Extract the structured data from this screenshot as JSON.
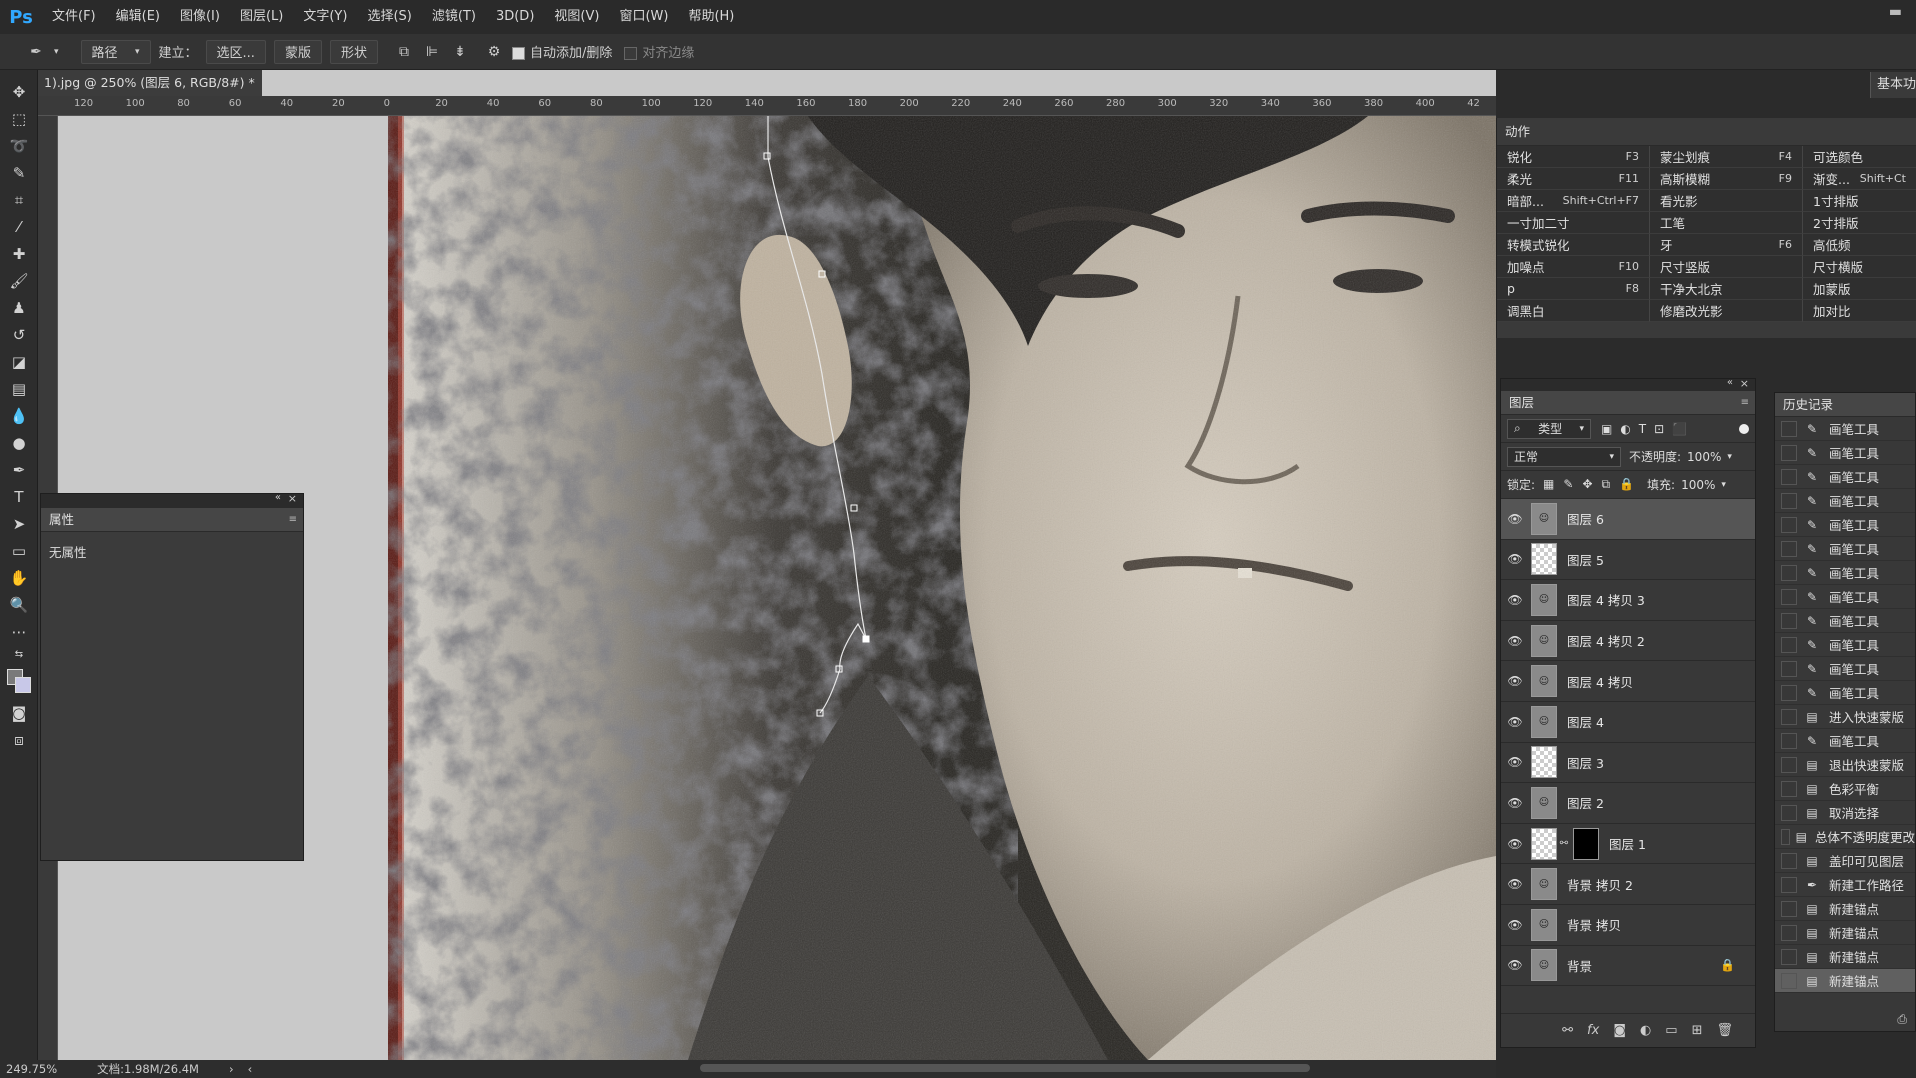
{
  "app": {
    "logo": "Ps"
  },
  "menu": [
    "文件(F)",
    "编辑(E)",
    "图像(I)",
    "图层(L)",
    "文字(Y)",
    "选择(S)",
    "滤镜(T)",
    "3D(D)",
    "视图(V)",
    "窗口(W)",
    "帮助(H)"
  ],
  "options": {
    "mode": "路径",
    "make_label": "建立：",
    "selection_btn": "选区...",
    "mask_btn": "蒙版",
    "shape_btn": "形状",
    "auto_add": "自动添加/删除",
    "align_edges": "对齐边缘",
    "workspace": "基本功能"
  },
  "document": {
    "tab_title": "1).jpg @ 250% (图层 6, RGB/8#) *",
    "ruler_ticks": [
      "120",
      "100",
      "80",
      "60",
      "40",
      "20",
      "0",
      "20",
      "40",
      "60",
      "80",
      "100",
      "120",
      "140",
      "160",
      "180",
      "200",
      "220",
      "240",
      "260",
      "280",
      "300",
      "320",
      "340",
      "360",
      "380",
      "400",
      "42"
    ]
  },
  "properties": {
    "title": "属性",
    "body": "无属性"
  },
  "actions": {
    "title": "动作",
    "items": [
      {
        "label": "锐化",
        "key": "F3"
      },
      {
        "label": "蒙尘划痕",
        "key": "F4"
      },
      {
        "label": "可选颜色",
        "key": ""
      },
      {
        "label": "柔光",
        "key": "F11"
      },
      {
        "label": "高斯模糊",
        "key": "F9"
      },
      {
        "label": "渐变...",
        "key": "Shift+Ct"
      },
      {
        "label": "暗部...",
        "key": "Shift+Ctrl+F7"
      },
      {
        "label": "看光影",
        "key": ""
      },
      {
        "label": "1寸排版",
        "key": ""
      },
      {
        "label": "一寸加二寸",
        "key": ""
      },
      {
        "label": "工笔",
        "key": ""
      },
      {
        "label": "2寸排版",
        "key": ""
      },
      {
        "label": "转模式锐化",
        "key": ""
      },
      {
        "label": "牙",
        "key": "F6"
      },
      {
        "label": "高低频",
        "key": ""
      },
      {
        "label": "加噪点",
        "key": "F10"
      },
      {
        "label": "尺寸竖版",
        "key": ""
      },
      {
        "label": "尺寸横版",
        "key": ""
      },
      {
        "label": "p",
        "key": "F8"
      },
      {
        "label": "干净大北京",
        "key": ""
      },
      {
        "label": "加蒙版",
        "key": ""
      },
      {
        "label": "调黑白",
        "key": ""
      },
      {
        "label": "修磨改光影",
        "key": ""
      },
      {
        "label": "加对比",
        "key": ""
      }
    ]
  },
  "layers": {
    "title": "图层",
    "filter": "类型",
    "blend": "正常",
    "opacity_label": "不透明度:",
    "opacity": "100%",
    "lock_label": "锁定:",
    "fill_label": "填充:",
    "fill": "100%",
    "items": [
      {
        "name": "图层 6",
        "selected": true,
        "thumb": "photo"
      },
      {
        "name": "图层 5",
        "selected": false,
        "thumb": "trans"
      },
      {
        "name": "图层 4 拷贝 3",
        "selected": false,
        "thumb": "photo"
      },
      {
        "name": "图层 4 拷贝 2",
        "selected": false,
        "thumb": "photo"
      },
      {
        "name": "图层 4 拷贝",
        "selected": false,
        "thumb": "photo"
      },
      {
        "name": "图层 4",
        "selected": false,
        "thumb": "photo"
      },
      {
        "name": "图层 3",
        "selected": false,
        "thumb": "trans"
      },
      {
        "name": "图层 2",
        "selected": false,
        "thumb": "photo"
      },
      {
        "name": "图层 1",
        "selected": false,
        "thumb": "trans-mask"
      },
      {
        "name": "背景 拷贝 2",
        "selected": false,
        "thumb": "photo"
      },
      {
        "name": "背景 拷贝",
        "selected": false,
        "thumb": "photo"
      },
      {
        "name": "背景",
        "selected": false,
        "thumb": "photo",
        "locked": true
      }
    ]
  },
  "history": {
    "title": "历史记录",
    "items": [
      {
        "label": "画笔工具",
        "icon": "brush-icon"
      },
      {
        "label": "画笔工具",
        "icon": "brush-icon"
      },
      {
        "label": "画笔工具",
        "icon": "brush-icon"
      },
      {
        "label": "画笔工具",
        "icon": "brush-icon"
      },
      {
        "label": "画笔工具",
        "icon": "brush-icon"
      },
      {
        "label": "画笔工具",
        "icon": "brush-icon"
      },
      {
        "label": "画笔工具",
        "icon": "brush-icon"
      },
      {
        "label": "画笔工具",
        "icon": "brush-icon"
      },
      {
        "label": "画笔工具",
        "icon": "brush-icon"
      },
      {
        "label": "画笔工具",
        "icon": "brush-icon"
      },
      {
        "label": "画笔工具",
        "icon": "brush-icon"
      },
      {
        "label": "画笔工具",
        "icon": "brush-icon"
      },
      {
        "label": "进入快速蒙版",
        "icon": "doc-icon"
      },
      {
        "label": "画笔工具",
        "icon": "brush-icon"
      },
      {
        "label": "退出快速蒙版",
        "icon": "doc-icon"
      },
      {
        "label": "色彩平衡",
        "icon": "doc-icon"
      },
      {
        "label": "取消选择",
        "icon": "doc-icon"
      },
      {
        "label": "总体不透明度更改",
        "icon": "doc-icon"
      },
      {
        "label": "盖印可见图层",
        "icon": "doc-icon"
      },
      {
        "label": "新建工作路径",
        "icon": "pen-icon"
      },
      {
        "label": "新建锚点",
        "icon": "doc-icon"
      },
      {
        "label": "新建锚点",
        "icon": "doc-icon"
      },
      {
        "label": "新建锚点",
        "icon": "doc-icon"
      },
      {
        "label": "新建锚点",
        "icon": "doc-icon",
        "selected": true
      }
    ]
  },
  "status": {
    "zoom": "249.75%",
    "doc": "文档:1.98M/26.4M"
  }
}
